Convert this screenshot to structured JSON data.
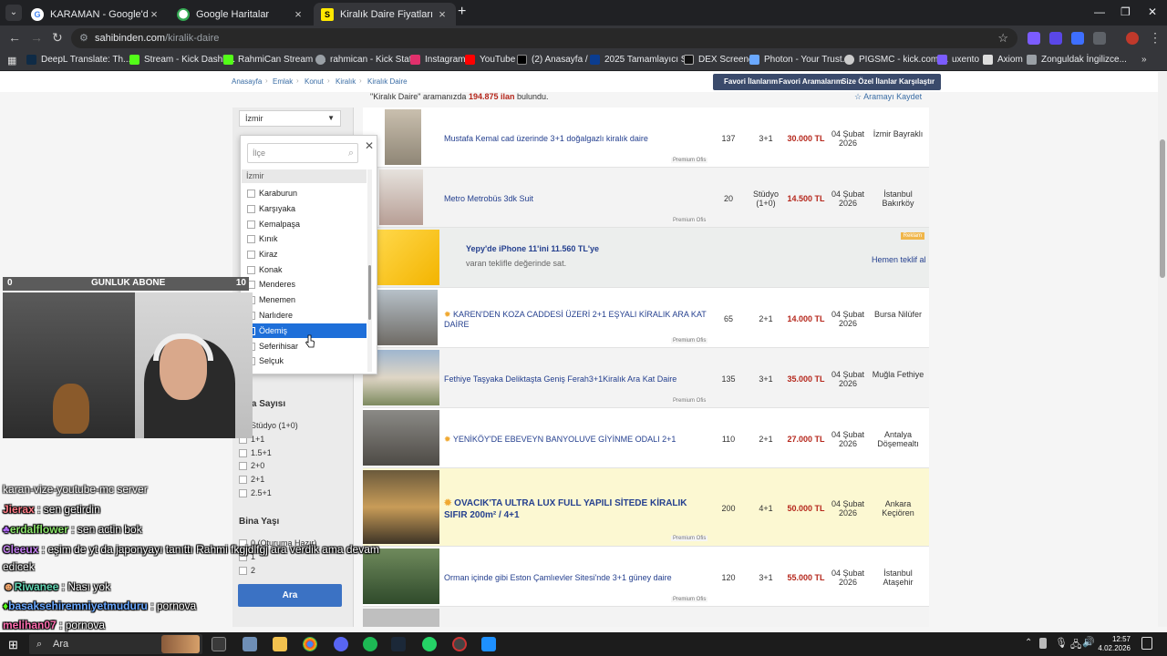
{
  "browser": {
    "tabs": [
      {
        "title": "KARAMAN - Google'da Ara",
        "active": false
      },
      {
        "title": "Google Haritalar",
        "active": false
      },
      {
        "title": "Kiralık Daire Fiyatları ve Kiralık İ",
        "active": true
      }
    ],
    "url_host": "sahibinden.com",
    "url_path": "/kiralik-daire",
    "bookmarks": [
      "DeepL Translate: Th...",
      "Stream - Kick Dashb...",
      "RahmiCan Stream -...",
      "rahmican - Kick Stat...",
      "Instagram",
      "YouTube",
      "(2) Anasayfa / X",
      "2025 Tamamlayıcı S...",
      "DEX Screener",
      "Photon - Your Trust...",
      "PIGSMC - kick.com/...",
      "uxento",
      "Axiom",
      "Zonguldak İngilizce..."
    ]
  },
  "page": {
    "breadcrumbs": [
      "Anasayfa",
      "Emlak",
      "Konut",
      "Kiralık",
      "Kiralık Daire"
    ],
    "topnav": [
      "Favori İlanlarım",
      "Favori Aramalarım",
      "Size Özel İlanlar",
      "Karşılaştır"
    ],
    "result_prefix": "\"Kiralık Daire\" aramanızda",
    "result_count": "194.875 ilan",
    "result_suffix": "bulundu.",
    "save_search": "Aramayı Kaydet",
    "city_select": "İzmir",
    "dropdown": {
      "placeholder": "İlçe",
      "group": "İzmir",
      "items": [
        "Karaburun",
        "Karşıyaka",
        "Kemalpaşa",
        "Kınık",
        "Kiraz",
        "Konak",
        "Menderes",
        "Menemen",
        "Narlıdere",
        "Ödemiş",
        "Seferihisar",
        "Selçuk"
      ],
      "highlighted": "Ödemiş"
    },
    "rooms_heading": "Oda Sayısı",
    "rooms_options": [
      "Stüdyo (1+0)",
      "1+1",
      "1.5+1",
      "2+0",
      "2+1",
      "2.5+1"
    ],
    "floor_heading": "Bina Yaşı",
    "floor_options": [
      "0 (Oturuma Hazır)",
      "1",
      "2"
    ],
    "search_button": "Ara",
    "listings": [
      {
        "title": "Mustafa Kemal cad üzerinde 3+1 doğalgazlı kiralık daire",
        "m2": "137",
        "rooms": "3+1",
        "price": "30.000 TL",
        "date": "04 Şubat 2026",
        "loc": "İzmir Bayraklı",
        "premium": "Premium Ofis"
      },
      {
        "title": "Metro Metrobüs 3dk Suit",
        "m2": "20",
        "rooms": "Stüdyo (1+0)",
        "price": "14.500 TL",
        "date": "04 Şubat 2026",
        "loc": "İstanbul Bakırköy",
        "premium": "Premium Ofis"
      },
      {
        "ad": true,
        "title": "Yepy'de iPhone 11'ini 11.560 TL'ye",
        "sub": "varan teklifle değerinde sat.",
        "cta": "Hemen teklif al",
        "tag": "Reklam"
      },
      {
        "title": "KAREN'DEN KOZA CADDESİ ÜZERİ 2+1 EŞYALI KİRALIK ARA KAT DAİRE",
        "m2": "65",
        "rooms": "2+1",
        "price": "14.000 TL",
        "date": "04 Şubat 2026",
        "loc": "Bursa Nilüfer",
        "premium": "Premium Ofis"
      },
      {
        "title": "Fethiye Taşyaka Deliktaşta Geniş Ferah3+1Kiralık Ara Kat Daire",
        "m2": "135",
        "rooms": "3+1",
        "price": "35.000 TL",
        "date": "04 Şubat 2026",
        "loc": "Muğla Fethiye",
        "premium": "Premium Ofis"
      },
      {
        "title": "YENİKÖY'DE EBEVEYN BANYOLUVE GİYİNME ODALI 2+1",
        "m2": "110",
        "rooms": "2+1",
        "price": "27.000 TL",
        "date": "04 Şubat 2026",
        "loc": "Antalya Döşemealtı"
      },
      {
        "title": "OVACIK'TA ULTRA LUX FULL YAPILI SİTEDE KİRALIK SIFIR 200m² / 4+1",
        "m2": "200",
        "rooms": "4+1",
        "price": "50.000 TL",
        "date": "04 Şubat 2026",
        "loc": "Ankara Keçiören",
        "premium": "Premium Ofis",
        "highlight": true
      },
      {
        "title": "Orman içinde gibi Eston Çamlıevler Sitesi'nde 3+1 güney daire",
        "m2": "120",
        "rooms": "3+1",
        "price": "55.000 TL",
        "date": "04 Şubat 2026",
        "loc": "İstanbul Ataşehir",
        "premium": "Premium Ofis"
      }
    ]
  },
  "overlay": {
    "sub_left": "0",
    "sub_label": "GUNLUK ABONE",
    "sub_right": "10",
    "chat": [
      {
        "user": "",
        "text": "karan-vize-youtube-mc server",
        "color": "#ffffff"
      },
      {
        "user": "Jierax",
        "text": ": sen getirdin",
        "color": "#ff7b86"
      },
      {
        "user": "erdalflower",
        "text": ": sen actin bok",
        "color": "#8be36b"
      },
      {
        "user": "Cleeux",
        "text": ": eşim de yt da japonyayı tanıttı Rahmi fkgjdlfgj ara verdik ama devam",
        "color": "#c27df0"
      },
      {
        "user": "",
        "text": "edicek",
        "color": "#ffffff"
      },
      {
        "user": "Riwanee",
        "text": ": Nası yok",
        "color": "#63d6b4"
      },
      {
        "user": "basaksehiremniyetmuduru",
        "text": ": pornova",
        "color": "#6aa8ff"
      },
      {
        "user": "melihan07",
        "text": ": pornova",
        "color": "#ff6fb1"
      }
    ]
  },
  "taskbar": {
    "search": "Ara",
    "time": "12:57",
    "date": "4.02.2026"
  }
}
